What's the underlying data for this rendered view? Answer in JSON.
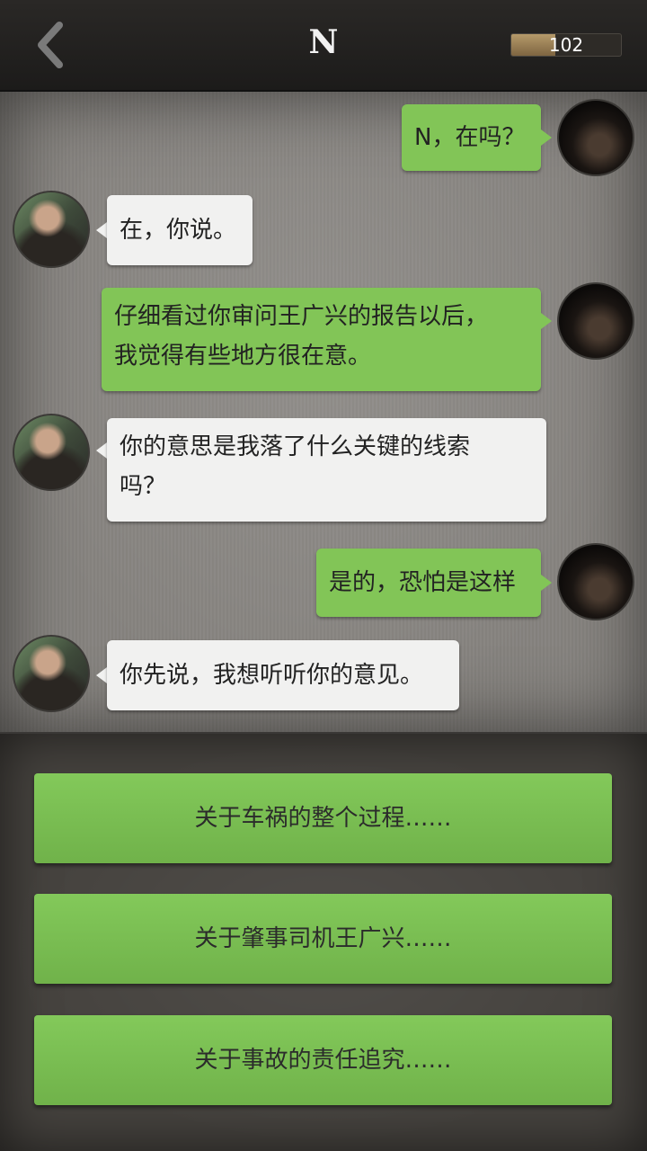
{
  "header": {
    "title": "N",
    "coins": "102"
  },
  "messages": [
    {
      "from": "me",
      "text": "N，在吗？"
    },
    {
      "from": "other",
      "text": "在，你说。"
    },
    {
      "from": "me",
      "line1": "仔细看过你审问王广兴的报告以后，",
      "line2": "我觉得有些地方很在意。"
    },
    {
      "from": "other",
      "line1": "你的意思是我落了什么关键的线索",
      "line2": "吗？"
    },
    {
      "from": "me",
      "text": "是的，恐怕是这样"
    },
    {
      "from": "other",
      "text": "你先说，我想听听你的意见。"
    }
  ],
  "options": [
    "关于车祸的整个过程……",
    "关于肇事司机王广兴……",
    "关于事故的责任追究……"
  ],
  "colors": {
    "my_bubble": "#82c557",
    "other_bubble": "#f1f1f0",
    "option": "#7dc155"
  }
}
